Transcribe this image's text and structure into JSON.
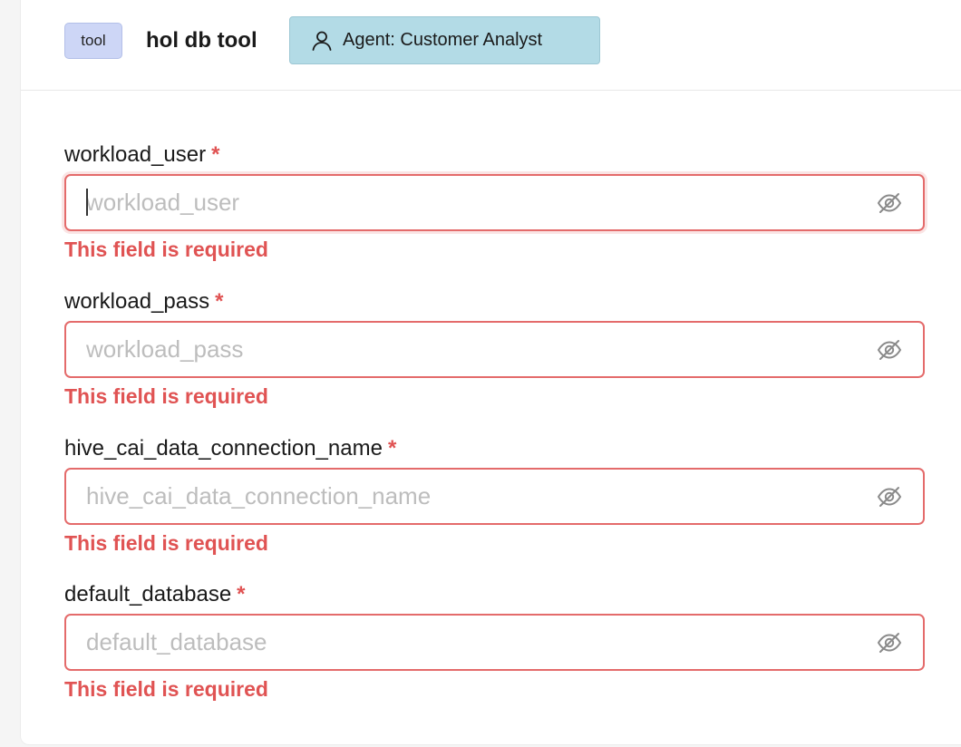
{
  "header": {
    "tag": "tool",
    "tool_name": "hol db tool",
    "agent_badge": "Agent: Customer Analyst",
    "agent_icon": "user-icon"
  },
  "fields": [
    {
      "label": "workload_user",
      "required_mark": "*",
      "placeholder": "workload_user",
      "value": "",
      "error": "This field is required",
      "toggle_icon": "eye-off-icon"
    },
    {
      "label": "workload_pass",
      "required_mark": "*",
      "placeholder": "workload_pass",
      "value": "",
      "error": "This field is required",
      "toggle_icon": "eye-off-icon"
    },
    {
      "label": "hive_cai_data_connection_name",
      "required_mark": "*",
      "placeholder": "hive_cai_data_connection_name",
      "value": "",
      "error": "This field is required",
      "toggle_icon": "eye-off-icon"
    },
    {
      "label": "default_database",
      "required_mark": "*",
      "placeholder": "default_database",
      "value": "",
      "error": "This field is required",
      "toggle_icon": "eye-off-icon"
    }
  ],
  "colors": {
    "error": "#e05353",
    "error_border": "#e46b6b",
    "tag_bg": "#cdd6f6",
    "agent_bg": "#b3dbe6",
    "placeholder": "#bdbdbd"
  }
}
